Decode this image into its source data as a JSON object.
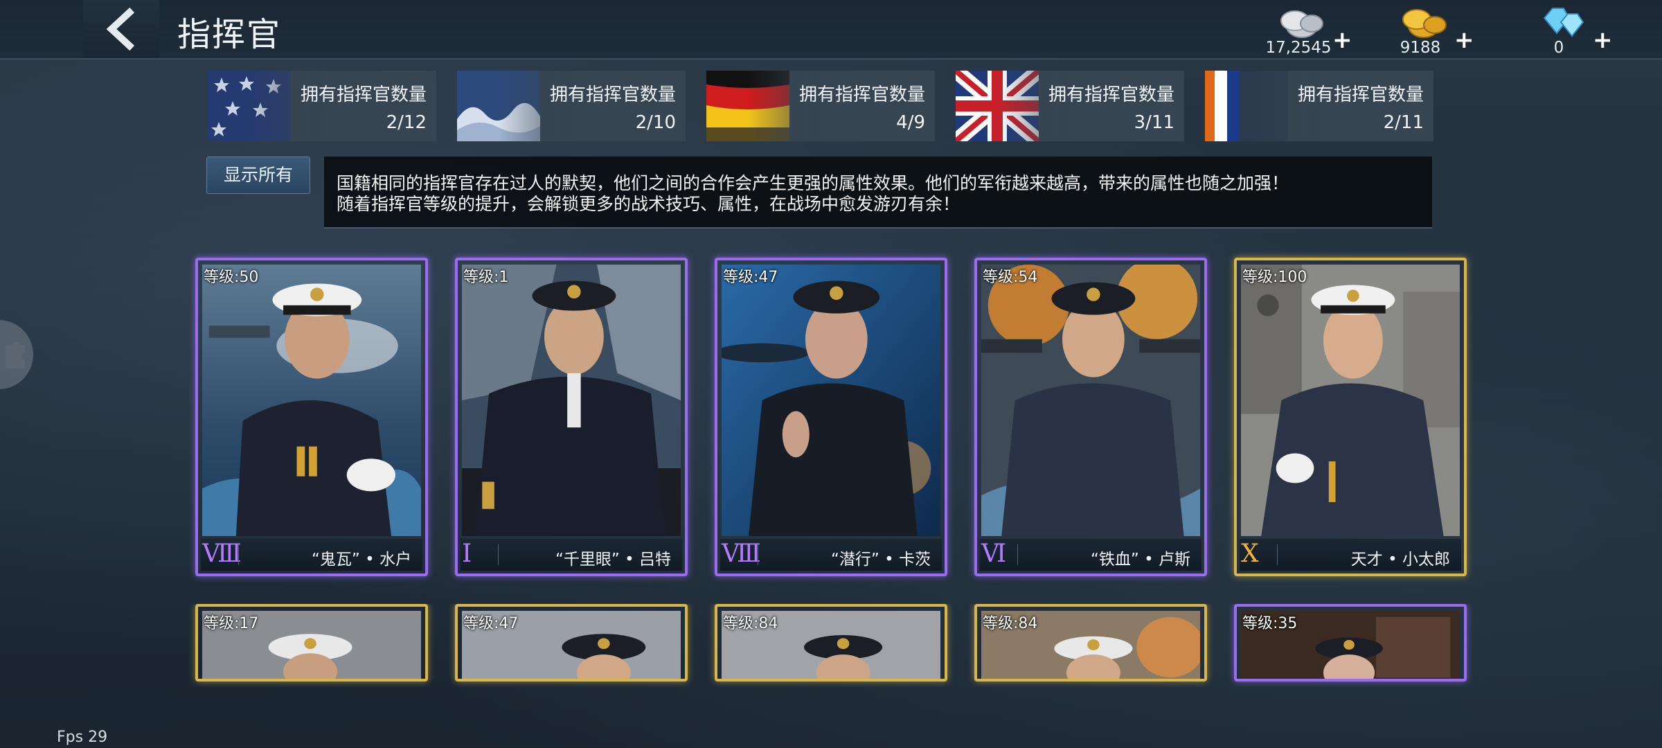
{
  "header": {
    "title": "指挥官",
    "currencies": [
      {
        "name": "silver",
        "amount": "17,2545",
        "plus": "+"
      },
      {
        "name": "gold",
        "amount": "9188",
        "plus": "+"
      },
      {
        "name": "diamond",
        "amount": "0",
        "plus": "+"
      }
    ]
  },
  "nations": [
    {
      "name": "usa",
      "label": "拥有指挥官数量",
      "count": "2/12"
    },
    {
      "name": "japan",
      "label": "拥有指挥官数量",
      "count": "2/10"
    },
    {
      "name": "germany",
      "label": "拥有指挥官数量",
      "count": "4/9"
    },
    {
      "name": "uk",
      "label": "拥有指挥官数量",
      "count": "3/11"
    },
    {
      "name": "other",
      "label": "拥有指挥官数量",
      "count": "2/11"
    }
  ],
  "filter": {
    "show_all_label": "显示所有"
  },
  "info": {
    "line1": "国籍相同的指挥官存在过人的默契，他们之间的合作会产生更强的属性效果。他们的军衔越来越高，带来的属性也随之加强！",
    "line2": "随着指挥官等级的提升，会解锁更多的战术技巧、属性，在战场中愈发游刃有余！"
  },
  "commanders": [
    {
      "level": "等级:50",
      "rank": "Ⅷ",
      "name": "“鬼瓦” • 水户",
      "tier": "purple"
    },
    {
      "level": "等级:1",
      "rank": "Ⅰ",
      "name": "“千里眼” • 吕特",
      "tier": "purple"
    },
    {
      "level": "等级:47",
      "rank": "Ⅷ",
      "name": "“潜行” • 卡茨",
      "tier": "purple"
    },
    {
      "level": "等级:54",
      "rank": "Ⅵ",
      "name": "“铁血” • 卢斯",
      "tier": "purple"
    },
    {
      "level": "等级:100",
      "rank": "Ⅹ",
      "name": "天才 • 小太郎",
      "tier": "gold"
    }
  ],
  "commanders_row2": [
    {
      "level": "等级:17",
      "tier": "gold"
    },
    {
      "level": "等级:47",
      "tier": "gold"
    },
    {
      "level": "等级:84",
      "tier": "gold"
    },
    {
      "level": "等级:84",
      "tier": "gold"
    },
    {
      "level": "等级:35",
      "tier": "purple"
    }
  ],
  "status": {
    "fps": "Fps 29"
  }
}
